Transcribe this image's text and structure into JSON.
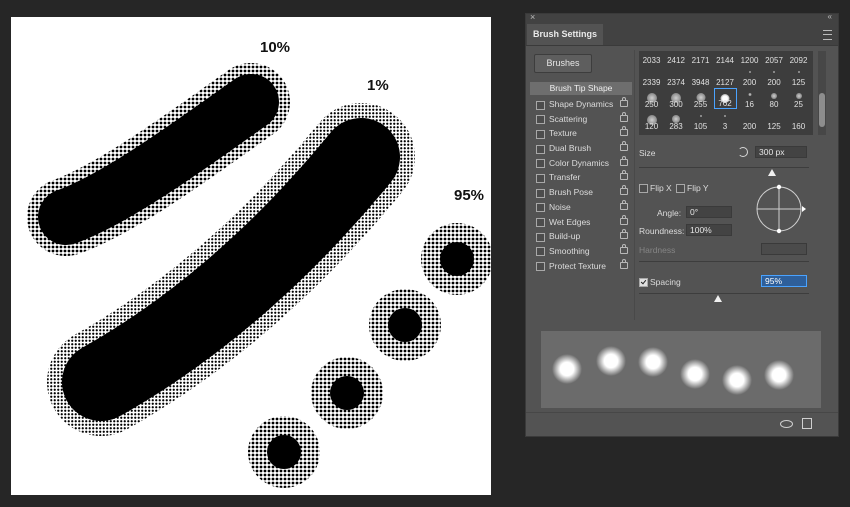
{
  "canvas": {
    "labels": {
      "ten": "10%",
      "one": "1%",
      "ninety_five": "95%"
    }
  },
  "panel": {
    "title": "Brush Settings",
    "close_glyph": "×",
    "collapse_glyph": "«",
    "menu_icon": "hamburger-menu-icon",
    "brushes_button": "Brushes",
    "brush_tip_shape": "Brush Tip Shape",
    "options": [
      {
        "label": "Shape Dynamics"
      },
      {
        "label": "Scattering"
      },
      {
        "label": "Texture"
      },
      {
        "label": "Dual Brush"
      },
      {
        "label": "Color Dynamics"
      },
      {
        "label": "Transfer"
      },
      {
        "label": "Brush Pose"
      },
      {
        "label": "Noise"
      },
      {
        "label": "Wet Edges"
      },
      {
        "label": "Build-up"
      },
      {
        "label": "Smoothing"
      },
      {
        "label": "Protect Texture"
      }
    ],
    "presets": [
      [
        "2033",
        "2412",
        "2171",
        "2144",
        "1200",
        "2057",
        "2092"
      ],
      [
        "2339",
        "2374",
        "3948",
        "2127",
        "200",
        "200",
        "125"
      ],
      [
        "250",
        "300",
        "255",
        "762",
        "16",
        "80",
        "25"
      ],
      [
        "120",
        "283",
        "105",
        "3",
        "200",
        "125",
        "160"
      ]
    ],
    "selected_preset": "762",
    "size": {
      "label": "Size",
      "value": "300 px"
    },
    "flip_x": "Flip X",
    "flip_y": "Flip Y",
    "angle": {
      "label": "Angle:",
      "value": "0°"
    },
    "roundness": {
      "label": "Roundness:",
      "value": "100%"
    },
    "hardness": {
      "label": "Hardness"
    },
    "spacing": {
      "label": "Spacing",
      "value": "95%",
      "checked": true
    },
    "accent_color": "#4aa3ff"
  }
}
